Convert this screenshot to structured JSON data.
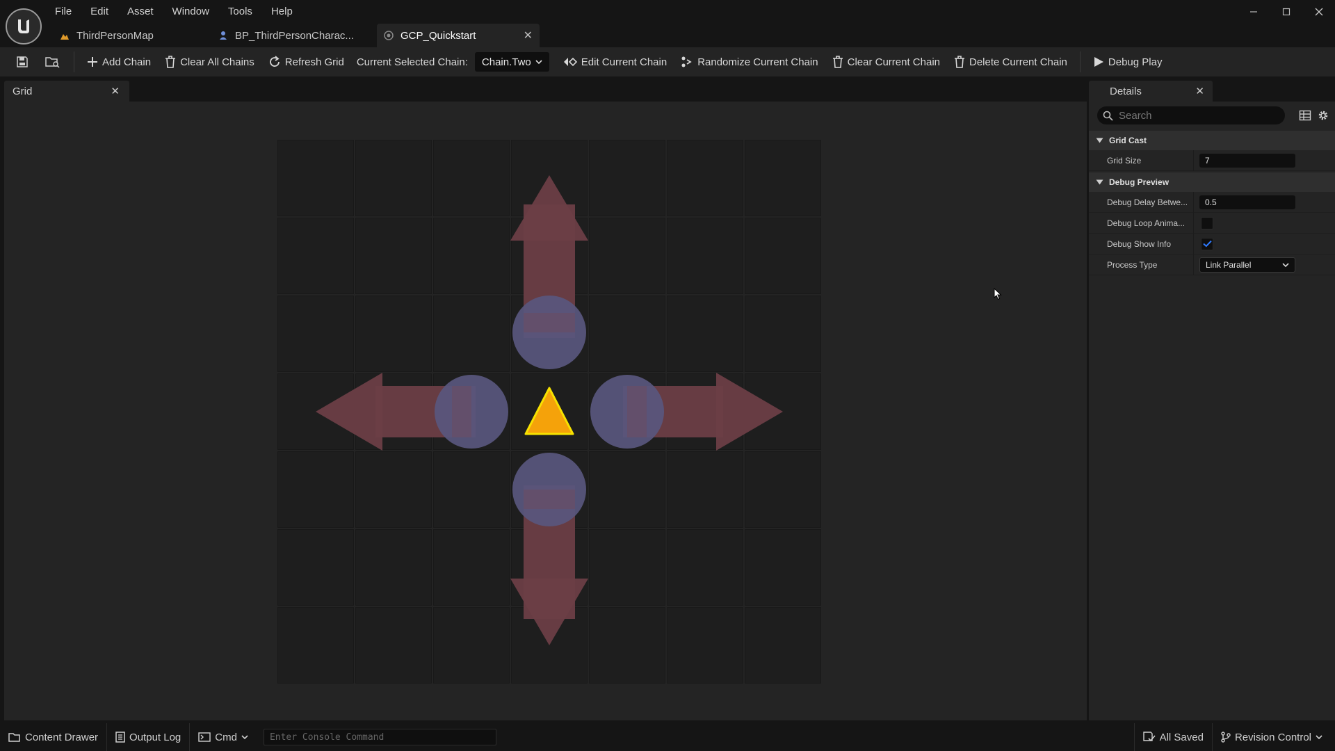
{
  "menu": [
    "File",
    "Edit",
    "Asset",
    "Window",
    "Tools",
    "Help"
  ],
  "doc_tabs": [
    {
      "label": "ThirdPersonMap",
      "icon": "level-icon"
    },
    {
      "label": "BP_ThirdPersonCharac...",
      "icon": "character-icon"
    },
    {
      "label": "GCP_Quickstart",
      "icon": "blueprint-icon",
      "active": true
    }
  ],
  "toolbar": {
    "add_chain": "Add Chain",
    "clear_all_chains": "Clear All Chains",
    "refresh_grid": "Refresh Grid",
    "current_chain_label": "Current Selected Chain:",
    "current_chain_value": "Chain.Two",
    "edit_current_chain": "Edit Current Chain",
    "randomize_current_chain": "Randomize Current Chain",
    "clear_current_chain": "Clear Current Chain",
    "delete_current_chain": "Delete Current Chain",
    "debug_play": "Debug Play"
  },
  "grid_panel": {
    "tab_label": "Grid",
    "grid_size": 7,
    "arrows": [
      "up",
      "right",
      "down",
      "left"
    ],
    "center_marker": "warning-triangle",
    "colors": {
      "arrow": "#6b3e46",
      "circle": "#59577e",
      "marker_fill": "#f5a20a",
      "marker_stroke": "#f7e200",
      "cell": "#1e1e1e",
      "cell_border": "#191919"
    }
  },
  "details": {
    "tab_label": "Details",
    "search_placeholder": "Search",
    "categories": [
      {
        "name": "Grid Cast"
      },
      {
        "name": "Debug Preview"
      }
    ],
    "grid_size_label": "Grid Size",
    "grid_size_value": "7",
    "debug_delay_label": "Debug Delay Betwe...",
    "debug_delay_value": "0.5",
    "debug_loop_label": "Debug Loop Anima...",
    "debug_loop_checked": false,
    "debug_show_info_label": "Debug Show Info",
    "debug_show_info_checked": true,
    "process_type_label": "Process Type",
    "process_type_value": "Link Parallel"
  },
  "statusbar": {
    "content_drawer": "Content Drawer",
    "output_log": "Output Log",
    "cmd": "Cmd",
    "console_placeholder": "Enter Console Command",
    "all_saved": "All Saved",
    "revision_control": "Revision Control"
  }
}
